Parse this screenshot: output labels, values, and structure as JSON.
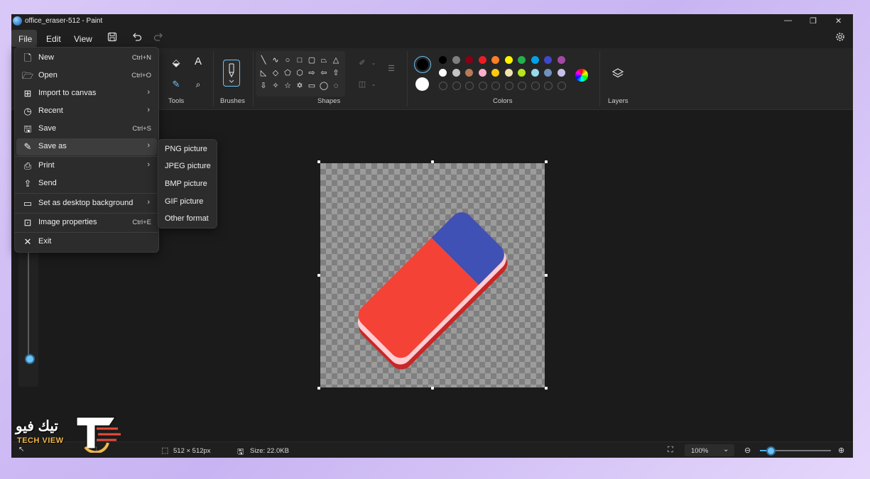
{
  "window": {
    "title": "office_eraser-512 - Paint"
  },
  "menubar": {
    "file": "File",
    "edit": "Edit",
    "view": "View"
  },
  "ribbon": {
    "tools_label": "Tools",
    "brushes_label": "Brushes",
    "shapes_label": "Shapes",
    "colors_label": "Colors",
    "layers_label": "Layers"
  },
  "colors": {
    "primary": "#000000",
    "secondary": "#ffffff",
    "row1": [
      "#000000",
      "#7f7f7f",
      "#880015",
      "#ed1c24",
      "#ff7f27",
      "#fff200",
      "#22b14c",
      "#00a2e8",
      "#3f48cc",
      "#a349a4"
    ],
    "row2": [
      "#ffffff",
      "#c3c3c3",
      "#b97a57",
      "#ffaec9",
      "#ffc90e",
      "#efe4b0",
      "#b5e61d",
      "#99d9ea",
      "#7092be",
      "#c8bfe7"
    ]
  },
  "file_menu": {
    "items": [
      {
        "label": "New",
        "shortcut": "Ctrl+N",
        "icon": "new-file-icon"
      },
      {
        "label": "Open",
        "shortcut": "Ctrl+O",
        "icon": "folder-icon"
      },
      {
        "label": "Import to canvas",
        "icon": "import-icon"
      },
      {
        "label": "Recent",
        "icon": "clock-icon"
      },
      {
        "label": "Save",
        "shortcut": "Ctrl+S",
        "icon": "save-icon"
      },
      {
        "label": "Save as",
        "icon": "save-as-icon"
      },
      {
        "label": "Print",
        "icon": "printer-icon"
      },
      {
        "label": "Send",
        "icon": "share-icon"
      },
      {
        "label": "Set as desktop background",
        "icon": "desktop-icon"
      },
      {
        "label": "Image properties",
        "shortcut": "Ctrl+E",
        "icon": "properties-icon"
      },
      {
        "label": "Exit",
        "icon": "close-icon"
      }
    ]
  },
  "save_as_submenu": [
    "PNG picture",
    "JPEG picture",
    "BMP picture",
    "GIF picture",
    "Other format"
  ],
  "status": {
    "dimensions": "512 × 512px",
    "size": "Size: 22.0KB",
    "zoom": "100%",
    "zoom_fraction": 0.25
  },
  "watermark": {
    "arabic": "تيك فيو",
    "english": "TECH VIEW"
  },
  "eraser_colors": {
    "blue": "#3f51b5",
    "red_main": "#f44336",
    "red_dark": "#c62828",
    "pink": "#ffcdd2"
  }
}
